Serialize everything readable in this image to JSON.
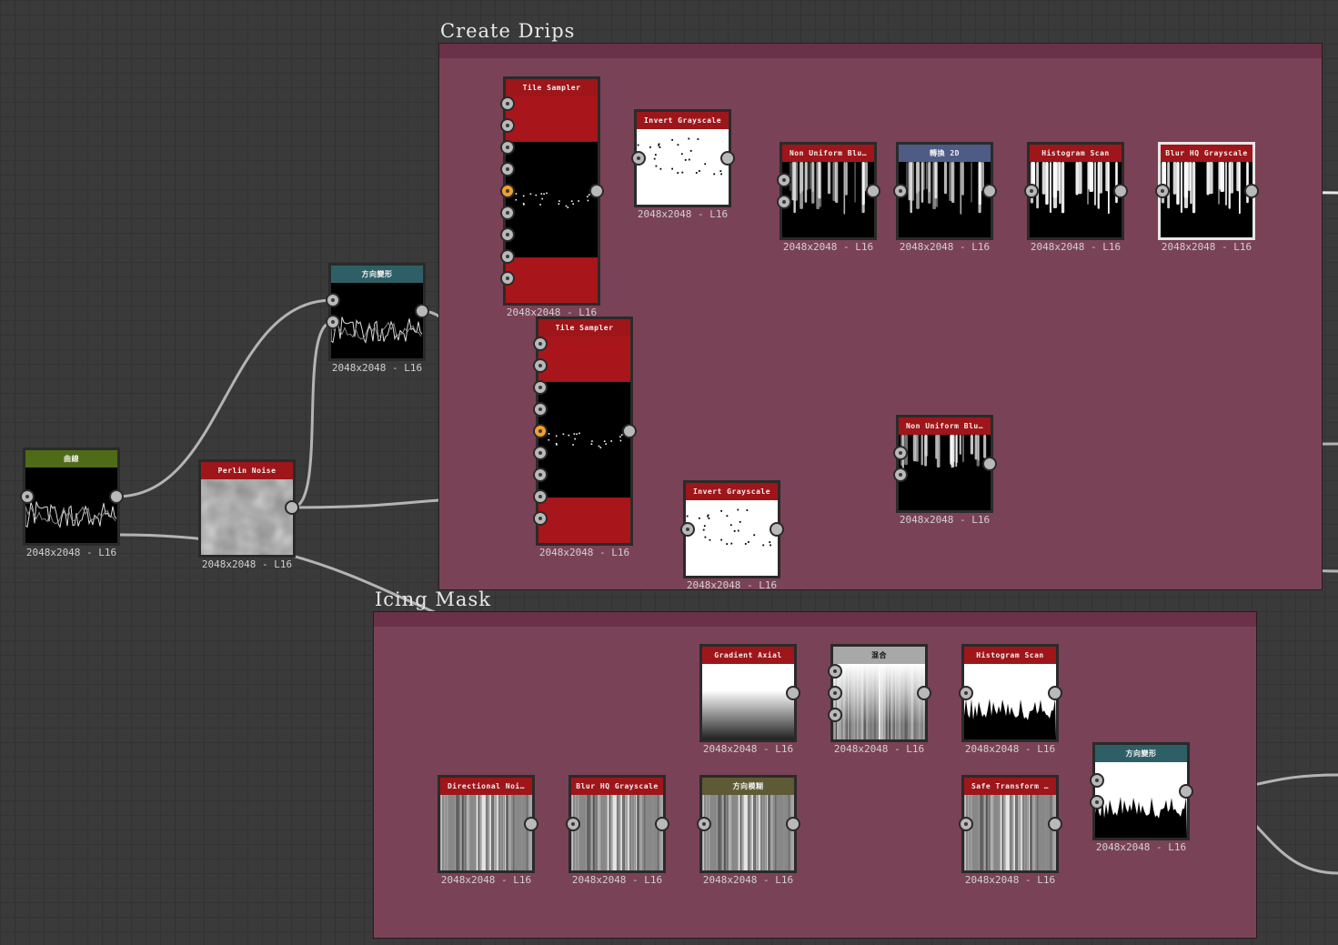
{
  "frames": [
    {
      "id": "create-drips",
      "title": "Create Drips"
    },
    {
      "id": "icing-mask",
      "title": "Icing Mask"
    }
  ],
  "colors": {
    "frame_fill": "#7a4256",
    "wire": "#b4b4b4",
    "header_red": "#9e161a",
    "header_teal": "#2f5f66",
    "header_green": "#4f6b18",
    "header_blue": "#4e5b85",
    "header_olive": "#5e5a36",
    "header_gray": "#a8a8a8",
    "active_port": "#f0a030"
  },
  "nodes": [
    {
      "id": "curve",
      "title": "曲線",
      "caption": "2048x2048 - L16",
      "header": "green",
      "thumb": "spiky-dark"
    },
    {
      "id": "perlin-noise",
      "title": "Perlin Noise",
      "caption": "2048x2048 - L16",
      "header": "red",
      "thumb": "perlin"
    },
    {
      "id": "dir-warp-1",
      "title": "方向變形",
      "caption": "2048x2048 - L16",
      "header": "teal",
      "thumb": "spiky-dark"
    },
    {
      "id": "tile-sampler-1",
      "title": "Tile Sampler",
      "caption": "2048x2048 - L16",
      "header": "red",
      "thumb": "tiles"
    },
    {
      "id": "invert-gray-1",
      "title": "Invert Grayscale",
      "caption": "2048x2048 - L16",
      "header": "red",
      "thumb": "white-dots"
    },
    {
      "id": "non-uniform-blur-1",
      "title": "Non Uniform Blu…",
      "caption": "2048x2048 - L16",
      "header": "red",
      "thumb": "drips"
    },
    {
      "id": "transform-2d",
      "title": "轉換 2D",
      "caption": "2048x2048 - L16",
      "header": "blue",
      "thumb": "drips"
    },
    {
      "id": "histogram-scan-1",
      "title": "Histogram Scan",
      "caption": "2048x2048 - L16",
      "header": "red",
      "thumb": "drips-bright"
    },
    {
      "id": "blur-hq-1",
      "title": "Blur HQ Grayscale",
      "caption": "2048x2048 - L16",
      "header": "red",
      "thumb": "drips-bright"
    },
    {
      "id": "tile-sampler-2",
      "title": "Tile Sampler",
      "caption": "2048x2048 - L16",
      "header": "red",
      "thumb": "tiles"
    },
    {
      "id": "invert-gray-2",
      "title": "Invert Grayscale",
      "caption": "2048x2048 - L16",
      "header": "red",
      "thumb": "white-dots"
    },
    {
      "id": "non-uniform-blur-2",
      "title": "Non Uniform Blu…",
      "caption": "2048x2048 - L16",
      "header": "red",
      "thumb": "drips-short"
    },
    {
      "id": "gradient-axial",
      "title": "Gradient Axial",
      "caption": "2048x2048 - L16",
      "header": "red",
      "thumb": "gradient"
    },
    {
      "id": "blend",
      "title": "混合",
      "caption": "2048x2048 - L16",
      "header": "gray",
      "thumb": "streaks-fade"
    },
    {
      "id": "histogram-scan-2",
      "title": "Histogram Scan",
      "caption": "2048x2048 - L16",
      "header": "red",
      "thumb": "white-spiky"
    },
    {
      "id": "directional-noise",
      "title": "Directional Noi…",
      "caption": "2048x2048 - L16",
      "header": "red",
      "thumb": "streaks"
    },
    {
      "id": "blur-hq-2",
      "title": "Blur HQ Grayscale",
      "caption": "2048x2048 - L16",
      "header": "red",
      "thumb": "streaks"
    },
    {
      "id": "dir-blur",
      "title": "方向模糊",
      "caption": "2048x2048 - L16",
      "header": "olive",
      "thumb": "streaks"
    },
    {
      "id": "safe-transform",
      "title": "Safe Transform …",
      "caption": "2048x2048 - L16",
      "header": "red",
      "thumb": "streaks"
    },
    {
      "id": "dir-warp-2",
      "title": "方向變形",
      "caption": "2048x2048 - L16",
      "header": "teal",
      "thumb": "white-spiky"
    }
  ]
}
